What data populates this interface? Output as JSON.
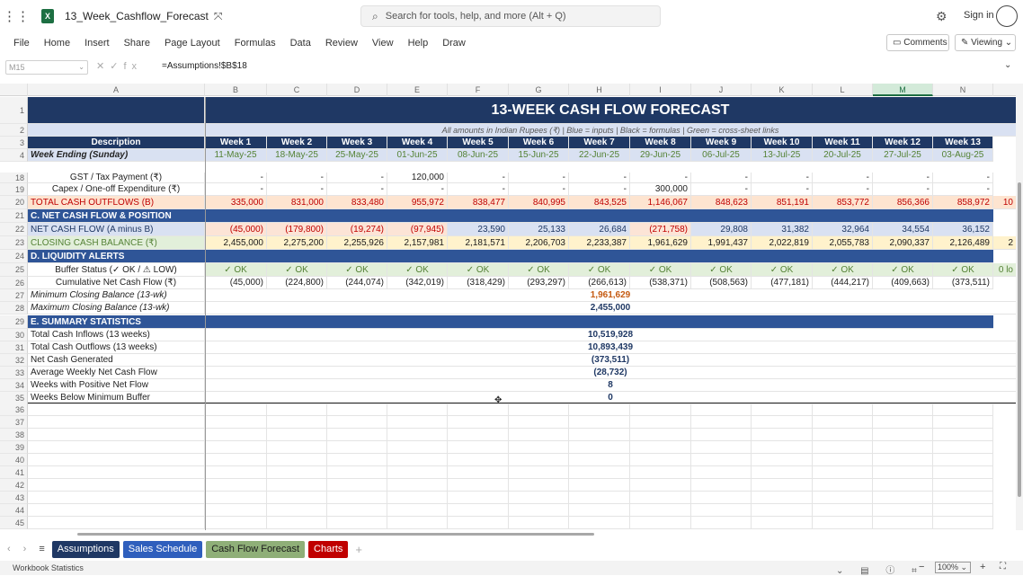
{
  "app": {
    "doc_title": "13_Week_Cashflow_Forecast",
    "search_placeholder": "Search for tools, help, and more (Alt + Q)",
    "sign_in": "Sign in"
  },
  "menu": [
    "File",
    "Home",
    "Insert",
    "Share",
    "Page Layout",
    "Formulas",
    "Data",
    "Review",
    "View",
    "Help",
    "Draw"
  ],
  "ribbon_right": {
    "comments": "Comments",
    "viewing": "Viewing"
  },
  "formula_bar": {
    "name_box": "M15",
    "formula": "=Assumptions!$B$18",
    "fx": "fx"
  },
  "columns": [
    "A",
    "B",
    "C",
    "D",
    "E",
    "F",
    "G",
    "H",
    "I",
    "J",
    "K",
    "L",
    "M",
    "N"
  ],
  "selected_column": "M",
  "sheet": {
    "title": "13-WEEK CASH FLOW FORECAST",
    "subtitle": "All amounts in Indian Rupees (₹)  |  Blue = inputs  |  Black = formulas  |  Green = cross-sheet links",
    "desc_header": "Description",
    "weeks": [
      "Week 1",
      "Week 2",
      "Week 3",
      "Week 4",
      "Week 5",
      "Week 6",
      "Week 7",
      "Week 8",
      "Week 9",
      "Week 10",
      "Week 11",
      "Week 12",
      "Week 13"
    ],
    "week_ending_label": "Week Ending (Sunday)",
    "dates": [
      "11-May-25",
      "18-May-25",
      "25-May-25",
      "01-Jun-25",
      "08-Jun-25",
      "15-Jun-25",
      "22-Jun-25",
      "29-Jun-25",
      "06-Jul-25",
      "13-Jul-25",
      "20-Jul-25",
      "27-Jul-25",
      "03-Aug-25"
    ],
    "row18": {
      "label": "GST / Tax Payment (₹)",
      "values": [
        "-",
        "-",
        "-",
        "120,000",
        "-",
        "-",
        "-",
        "-",
        "-",
        "-",
        "-",
        "-",
        "-"
      ]
    },
    "row19": {
      "label": "Capex / One-off Expenditure (₹)",
      "values": [
        "-",
        "-",
        "-",
        "-",
        "-",
        "-",
        "-",
        "300,000",
        "-",
        "-",
        "-",
        "-",
        "-"
      ]
    },
    "row20": {
      "label": "TOTAL CASH OUTFLOWS  (B)",
      "values": [
        "335,000",
        "831,000",
        "833,480",
        "955,972",
        "838,477",
        "840,995",
        "843,525",
        "1,146,067",
        "848,623",
        "851,191",
        "853,772",
        "856,366",
        "858,972"
      ],
      "overflow": "10"
    },
    "section_c": "C.  NET CASH FLOW & POSITION",
    "row22": {
      "label": "NET CASH FLOW  (A minus B)",
      "values": [
        "(45,000)",
        "(179,800)",
        "(19,274)",
        "(97,945)",
        "23,590",
        "25,133",
        "26,684",
        "(271,758)",
        "29,808",
        "31,382",
        "32,964",
        "34,554",
        "36,152"
      ]
    },
    "row23": {
      "label": "CLOSING CASH BALANCE (₹)",
      "values": [
        "2,455,000",
        "2,275,200",
        "2,255,926",
        "2,157,981",
        "2,181,571",
        "2,206,703",
        "2,233,387",
        "1,961,629",
        "1,991,437",
        "2,022,819",
        "2,055,783",
        "2,090,337",
        "2,126,489"
      ],
      "overflow": "2"
    },
    "section_d": "D.  LIQUIDITY ALERTS",
    "row25": {
      "label": "Buffer Status  (✓ OK  /  ⚠ LOW)",
      "values": [
        "✓ OK",
        "✓ OK",
        "✓ OK",
        "✓ OK",
        "✓ OK",
        "✓ OK",
        "✓ OK",
        "✓ OK",
        "✓ OK",
        "✓ OK",
        "✓ OK",
        "✓ OK",
        "✓ OK"
      ],
      "overflow": "0 lo"
    },
    "row26": {
      "label": "Cumulative Net Cash Flow (₹)",
      "values": [
        "(45,000)",
        "(224,800)",
        "(244,074)",
        "(342,019)",
        "(318,429)",
        "(293,297)",
        "(266,613)",
        "(538,371)",
        "(508,563)",
        "(477,181)",
        "(444,217)",
        "(409,663)",
        "(373,511)"
      ]
    },
    "row27": {
      "label": "Minimum Closing Balance (13-wk)",
      "value": "1,961,629"
    },
    "row28": {
      "label": "Maximum Closing Balance (13-wk)",
      "value": "2,455,000"
    },
    "section_e": "E.  SUMMARY STATISTICS",
    "summary": [
      {
        "label": "Total Cash Inflows (13 weeks)",
        "value": "10,519,928"
      },
      {
        "label": "Total Cash Outflows (13 weeks)",
        "value": "10,893,439"
      },
      {
        "label": "Net Cash Generated",
        "value": "(373,511)"
      },
      {
        "label": "Average Weekly Net Cash Flow",
        "value": "(28,732)"
      },
      {
        "label": "Weeks with Positive Net Flow",
        "value": "8"
      },
      {
        "label": "Weeks Below Minimum Buffer",
        "value": "0"
      }
    ],
    "row_numbers": [
      "1",
      "2",
      "3",
      "4",
      "18",
      "19",
      "20",
      "21",
      "22",
      "23",
      "24",
      "25",
      "26",
      "27",
      "28",
      "29",
      "30",
      "31",
      "32",
      "33",
      "34",
      "35",
      "36",
      "37",
      "38",
      "39",
      "40",
      "41",
      "42",
      "43",
      "44",
      "45"
    ]
  },
  "tabs": [
    {
      "label": "Assumptions",
      "bg": "#1f3864",
      "fg": "#ffffff"
    },
    {
      "label": "Sales Schedule",
      "bg": "#2f5fbd",
      "fg": "#ffffff"
    },
    {
      "label": "Cash Flow Forecast",
      "bg": "#8faf78",
      "fg": "#1a1a1a"
    },
    {
      "label": "Charts",
      "bg": "#c00000",
      "fg": "#ffffff"
    }
  ],
  "status": {
    "left": "Workbook Statistics",
    "zoom": "100%"
  },
  "colors": {
    "navy": "#1f3864",
    "section": "#2f5597",
    "lightblue": "#d9e1f2",
    "peach": "#fde4d0",
    "green_fill": "#e2efda",
    "yellow": "#fff2cc",
    "red_text": "#c00000",
    "link_green": "#548235"
  }
}
